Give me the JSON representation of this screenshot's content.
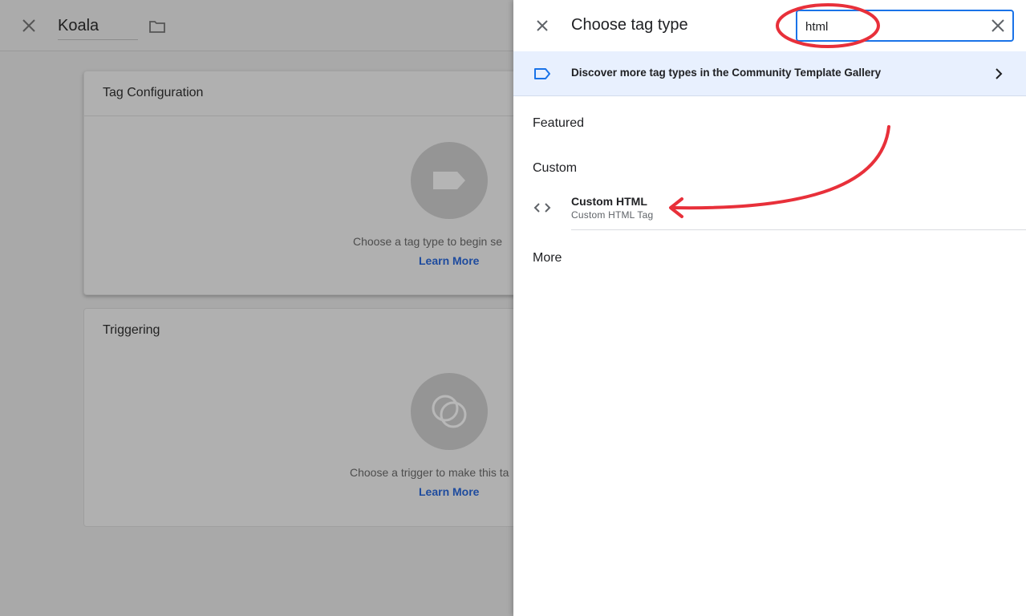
{
  "background": {
    "container_name": "Koala",
    "tag_config": {
      "title": "Tag Configuration",
      "hint": "Choose a tag type to begin se",
      "link": "Learn More"
    },
    "triggering": {
      "title": "Triggering",
      "hint": "Choose a trigger to make this ta",
      "link": "Learn More"
    }
  },
  "panel": {
    "title": "Choose tag type",
    "search": {
      "value": "html"
    },
    "gallery_banner": "Discover more tag types in the Community Template Gallery",
    "sections": {
      "featured": "Featured",
      "custom": "Custom",
      "more": "More"
    },
    "custom_items": [
      {
        "name": "Custom HTML",
        "description": "Custom HTML Tag",
        "icon": "code-brackets-icon"
      }
    ]
  },
  "colors": {
    "accent": "#1a73e8",
    "annotation": "#e8303a",
    "banner_bg": "#e8f0fe"
  }
}
